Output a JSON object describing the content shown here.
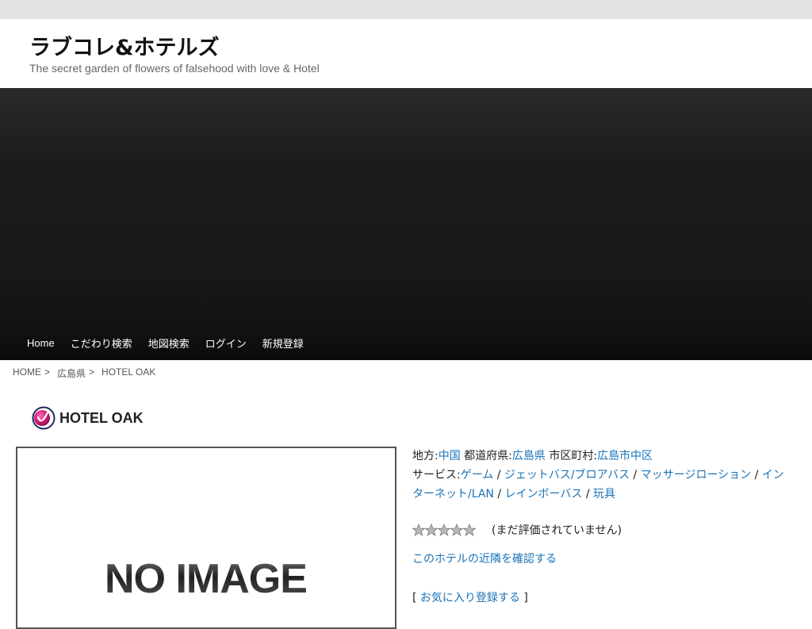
{
  "site": {
    "title": "ラブコレ&ホテルズ",
    "description": "The secret garden of flowers of falsehood with love & Hotel"
  },
  "nav": {
    "items": [
      "Home",
      "こだわり検索",
      "地図検索",
      "ログイン",
      "新規登録"
    ]
  },
  "breadcrumb": {
    "home": "HOME",
    "region": "広島県",
    "current": "HOTEL OAK",
    "sep": ">"
  },
  "hotel": {
    "name": "HOTEL OAK",
    "image_text": "NO IMAGE",
    "area_label": "地方:",
    "area": "中国",
    "pref_label": "都道府県:",
    "pref": "広島県",
    "city_label": "市区町村:",
    "city": "広島市中区",
    "service_label": "サービス:",
    "services": [
      "ゲーム",
      "ジェットバス/ブロアバス",
      "マッサージローション",
      "インターネット/LAN",
      "レインボーバス",
      "玩具"
    ],
    "service_sep": " / ",
    "rating_stars": 0,
    "rating_max": 5,
    "rating_text": "(まだ評価されていません)",
    "nearby_link": "このホテルの近隣を確認する",
    "fav_open": "[",
    "fav_link": "お気に入り登録する",
    "fav_close": "]"
  },
  "colors": {
    "link": "#1a73b8",
    "banner": "#1b1b1b",
    "topbar": "#e3e3e3"
  }
}
